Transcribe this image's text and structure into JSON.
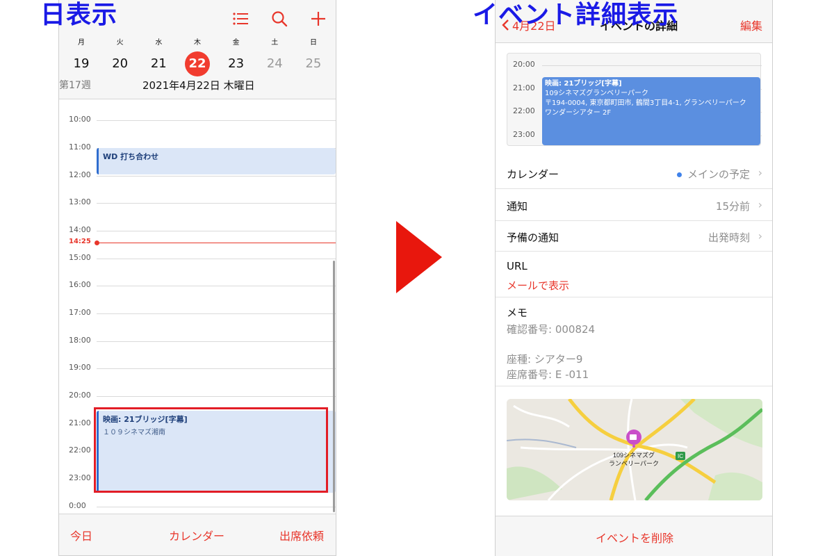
{
  "captions": {
    "left": "日表示",
    "right": "イベント詳細表示"
  },
  "day_view": {
    "weekdays": [
      "月",
      "火",
      "水",
      "木",
      "金",
      "土",
      "日"
    ],
    "dates": [
      "19",
      "20",
      "21",
      "22",
      "23",
      "24",
      "25"
    ],
    "today_index": 3,
    "weekend_indices": [
      5,
      6
    ],
    "week_number": "第17週",
    "full_date": "2021年4月22日 木曜日",
    "hours": [
      "10:00",
      "11:00",
      "12:00",
      "13:00",
      "14:00",
      "15:00",
      "16:00",
      "17:00",
      "18:00",
      "19:00",
      "20:00",
      "21:00",
      "22:00",
      "23:00",
      "0:00"
    ],
    "current_time": "14:25",
    "events": [
      {
        "title": "WD 打ち合わせ",
        "subtitle": ""
      },
      {
        "title": "映画: 21ブリッジ[字幕]",
        "subtitle": "１０９シネマズ湘南"
      }
    ],
    "toolbar": {
      "today": "今日",
      "calendars": "カレンダー",
      "inbox": "出席依頼"
    }
  },
  "detail_view": {
    "back_label": "4月22日",
    "nav_title": "イベントの詳細",
    "edit_label": "編集",
    "mini_hours": [
      "20:00",
      "21:00",
      "22:00",
      "23:00"
    ],
    "event": {
      "title": "映画: 21ブリッジ[字幕]",
      "venue": "109シネマズグランベリーパーク",
      "address": "〒194-0004, 東京都町田市, 鶴間3丁目4-1, グランベリーパーク",
      "room": "ワンダーシアター 2F"
    },
    "calendar_label": "カレンダー",
    "calendar_value": "メインの予定",
    "calendar_color": "#3f82ea",
    "alert_label": "通知",
    "alert_value": "15分前",
    "second_alert_label": "予備の通知",
    "second_alert_value": "出発時刻",
    "url_label": "URL",
    "url_link": "メールで表示",
    "notes_label": "メモ",
    "notes_line1": "確認番号: 000824",
    "notes_line2": "座種: シアター9",
    "notes_line3": "座席番号: E -011",
    "map_label_line1": "109シネマズグ",
    "map_label_line2": "ランベリーパーク",
    "map_ic": "IC",
    "delete_label": "イベントを削除"
  },
  "colors": {
    "accent_red": "#e8362b",
    "caption_blue": "#1a1ae6",
    "event_blue": "#5b8fe0",
    "arrow_red": "#e8170d"
  }
}
